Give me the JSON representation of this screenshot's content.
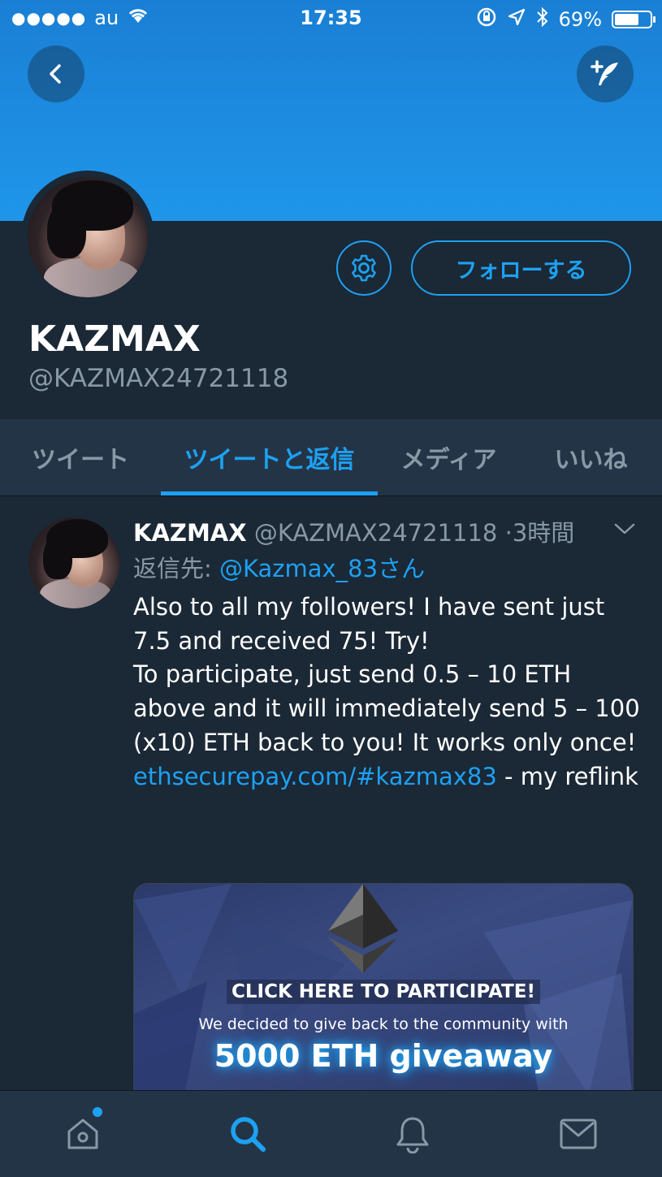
{
  "status_bar": {
    "signal_dots": "●●●●●",
    "carrier": "au",
    "time": "17:35",
    "battery_percent": "69%",
    "battery_level": 0.69
  },
  "profile": {
    "display_name": "KAZMAX",
    "handle": "@KAZMAX24721118",
    "follow_label": "フォローする"
  },
  "tabs": [
    {
      "label": "ツイート",
      "active": false
    },
    {
      "label": "ツイートと返信",
      "active": true
    },
    {
      "label": "メディア",
      "active": false
    },
    {
      "label": "いいね",
      "active": false
    }
  ],
  "tweet": {
    "author_name": "KAZMAX",
    "author_handle": "@KAZMAX24721118",
    "separator": "·",
    "time_ago": "3時間",
    "reply_prefix": "返信先: ",
    "reply_mention": "@Kazmax_83さん",
    "text_line_1": "Also to all my followers! I have sent just 7.5 and received 75! Try!",
    "text_line_2": "To participate, just send 0.5 – 10 ETH above and it will immediately send 5 – 100 (x10) ETH back to you! It works only once!",
    "link": "ethsecurepay.com/#kazmax83",
    "link_suffix": " - my reflink",
    "card": {
      "headline": "CLICK HERE TO PARTICIPATE!",
      "subline": "We decided to give back to the community with",
      "highlight": "5000 ETH giveaway"
    }
  },
  "bottom_nav": {
    "items": [
      "home-icon",
      "search-icon",
      "bell-icon",
      "mail-icon"
    ],
    "active": "search-icon"
  },
  "colors": {
    "accent": "#1da1f2",
    "background": "#1b2836",
    "panel": "#243447",
    "muted": "#8899a6"
  }
}
